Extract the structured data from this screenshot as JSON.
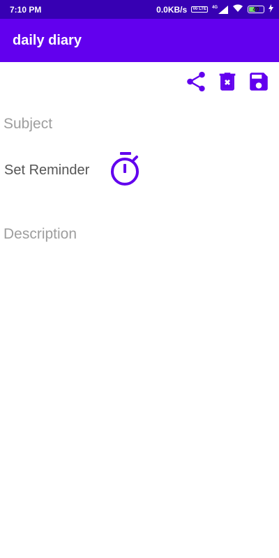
{
  "status_bar": {
    "time": "7:10 PM",
    "network_speed": "0.0KB/s",
    "volte_badge": "Vo LTE",
    "signal_badge": "4G",
    "battery_level": "49",
    "battery_fraction": 0.49
  },
  "app_bar": {
    "title": "daily diary"
  },
  "toolbar": {
    "share_icon": "share-icon",
    "delete_icon": "delete-icon",
    "save_icon": "save-icon"
  },
  "form": {
    "subject_placeholder": "Subject",
    "reminder_label": "Set Reminder",
    "reminder_icon": "timer-icon",
    "description_placeholder": "Description"
  },
  "colors": {
    "status_bar": "#3700b3",
    "app_bar": "#6200ee",
    "accent": "#6200ee",
    "hint_text": "#9e9e9e"
  }
}
